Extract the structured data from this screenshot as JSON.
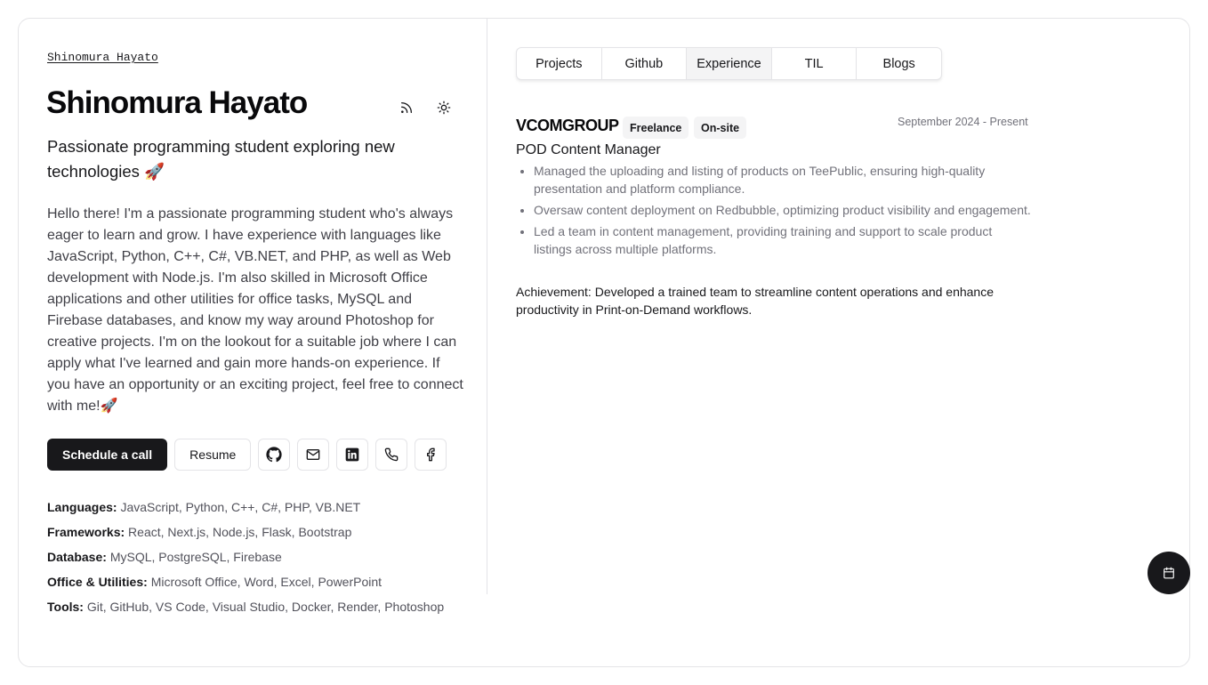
{
  "header": {
    "username": "Shinomura Hayato",
    "title": "Shinomura Hayato",
    "rss_icon": "rss-icon",
    "theme_icon": "sun-icon"
  },
  "profile": {
    "tagline": "Passionate programming student exploring new technologies 🚀",
    "bio": "Hello there! I'm a passionate programming student who's always eager to learn and grow. I have experience with languages like JavaScript, Python, C++, C#, VB.NET, and PHP, as well as Web development with Node.js. I'm also skilled in Microsoft Office applications and other utilities for office tasks, MySQL and Firebase databases, and know my way around Photoshop for creative projects. I'm on the lookout for a suitable job where I can apply what I've learned and gain more hands-on experience. If you have an opportunity or an exciting project, feel free to connect with me!🚀"
  },
  "actions": {
    "schedule_label": "Schedule a call",
    "resume_label": "Resume",
    "icons": [
      "github-icon",
      "mail-icon",
      "linkedin-icon",
      "phone-icon",
      "facebook-icon"
    ]
  },
  "skills": [
    {
      "label": "Languages:",
      "value": "JavaScript, Python, C++, C#, PHP, VB.NET"
    },
    {
      "label": "Frameworks:",
      "value": "React, Next.js, Node.js, Flask, Bootstrap"
    },
    {
      "label": "Database:",
      "value": "MySQL, PostgreSQL, Firebase"
    },
    {
      "label": "Office & Utilities:",
      "value": "Microsoft Office, Word, Excel, PowerPoint"
    },
    {
      "label": "Tools:",
      "value": "Git, GitHub, VS Code, Visual Studio, Docker, Render, Photoshop"
    }
  ],
  "tabs": [
    {
      "label": "Projects",
      "active": false
    },
    {
      "label": "Github",
      "active": false
    },
    {
      "label": "Experience",
      "active": true
    },
    {
      "label": "TIL",
      "active": false
    },
    {
      "label": "Blogs",
      "active": false
    }
  ],
  "experience": {
    "company": "VCOMGROUP",
    "badges": [
      "Freelance",
      "On-site"
    ],
    "date": "September 2024 - Present",
    "role": "POD Content Manager",
    "bullets": [
      "Managed the uploading and listing of products on TeePublic, ensuring high-quality presentation and platform compliance.",
      "Oversaw content deployment on Redbubble, optimizing product visibility and engagement.",
      "Led a team in content management, providing training and support to scale product listings across multiple platforms."
    ],
    "achievement": "Achievement: Developed a trained team to streamline content operations and enhance productivity in Print-on-Demand workflows."
  },
  "fab": {
    "icon": "calendar-icon"
  },
  "colors": {
    "primary": "#18181b",
    "border": "#e4e4e7",
    "muted": "#71717a"
  }
}
